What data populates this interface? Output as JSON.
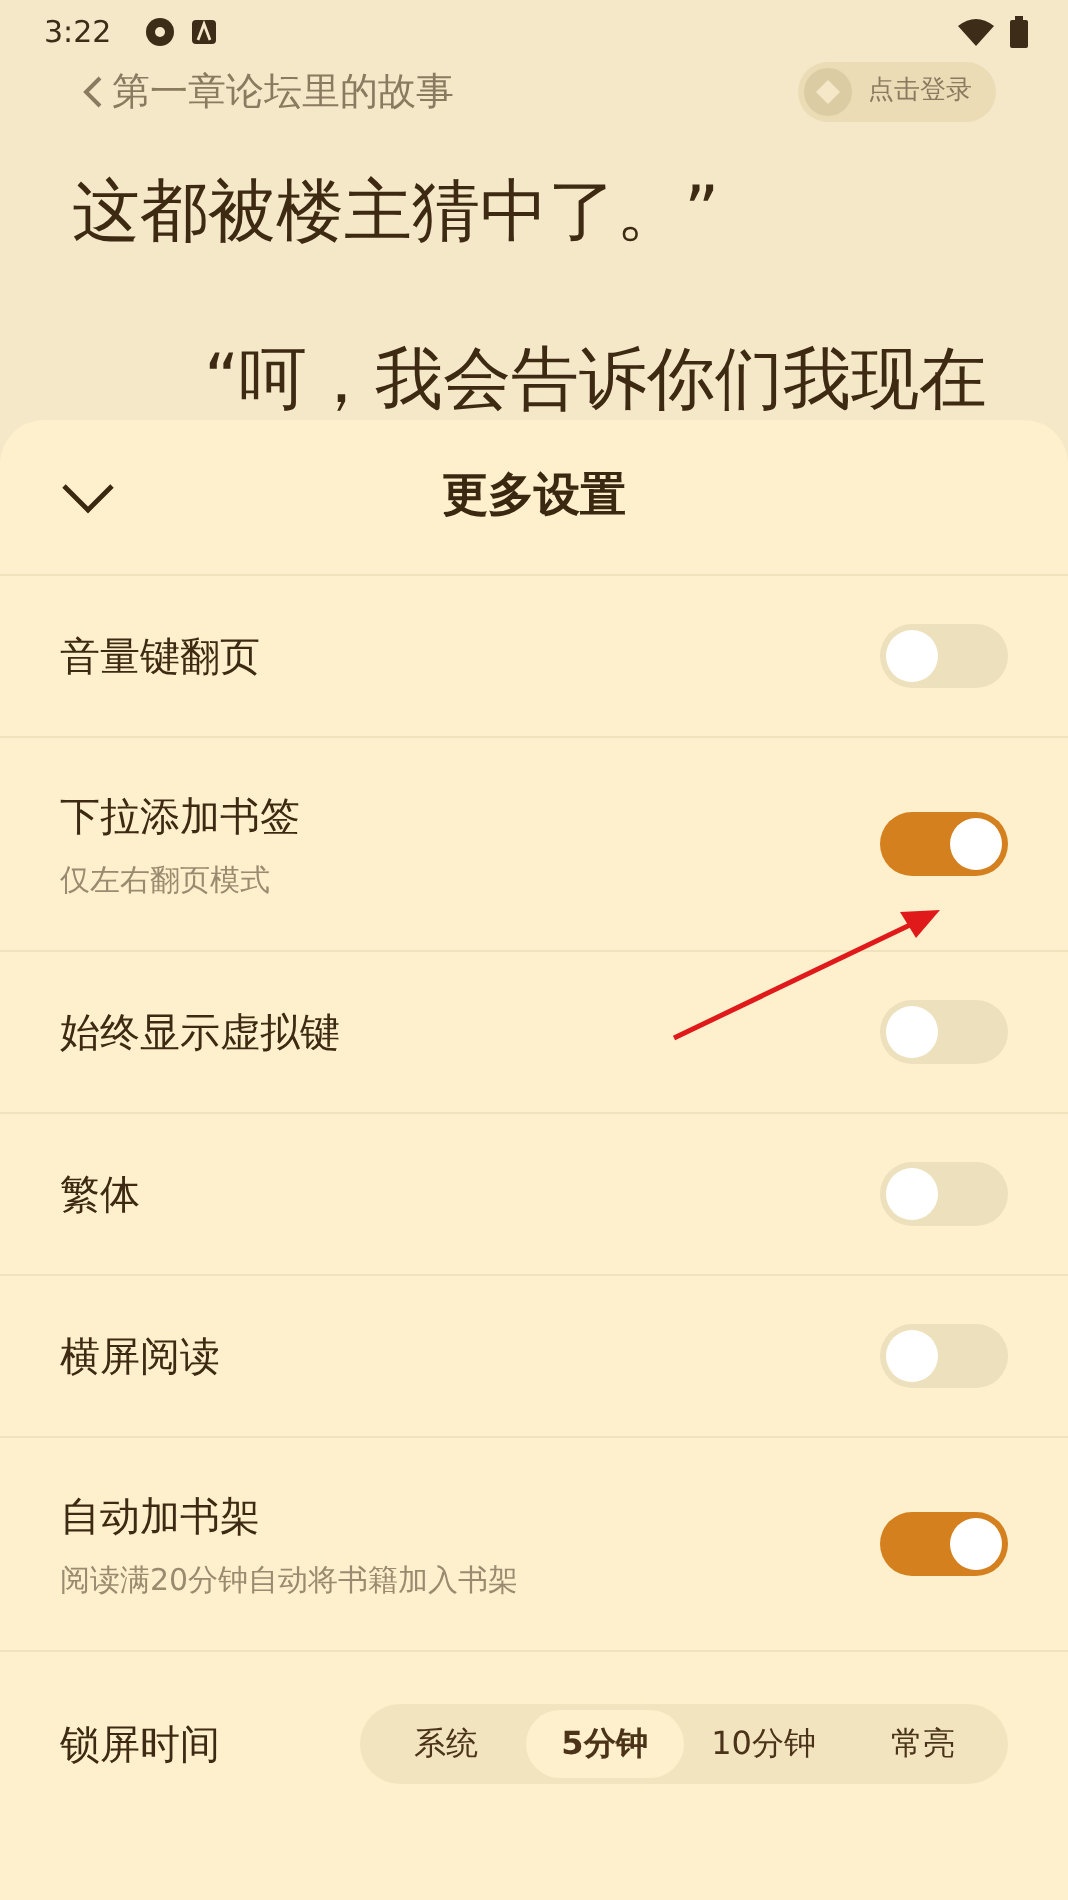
{
  "status_bar": {
    "time": "3:22"
  },
  "reader": {
    "chapter_title": "第一章论坛里的故事",
    "login_button": "点击登录",
    "lines": [
      "这都被楼主猜中了。”",
      "“呵，我会告诉你们我现在"
    ]
  },
  "sheet": {
    "title": "更多设置",
    "settings": [
      {
        "label": "音量键翻页",
        "on": false
      },
      {
        "label": "下拉添加书签",
        "subtitle": "仅左右翻页模式",
        "on": true
      },
      {
        "label": "始终显示虚拟键",
        "on": false
      },
      {
        "label": "繁体",
        "on": false
      },
      {
        "label": "横屏阅读",
        "on": false
      },
      {
        "label": "自动加书架",
        "subtitle": "阅读满20分钟自动将书籍加入书架",
        "on": true
      }
    ],
    "lock_screen": {
      "label": "锁屏时间",
      "options": [
        {
          "label": "系统",
          "selected": false
        },
        {
          "label": "5分钟",
          "selected": true
        },
        {
          "label": "10分钟",
          "selected": false
        },
        {
          "label": "常亮",
          "selected": false
        }
      ]
    }
  }
}
